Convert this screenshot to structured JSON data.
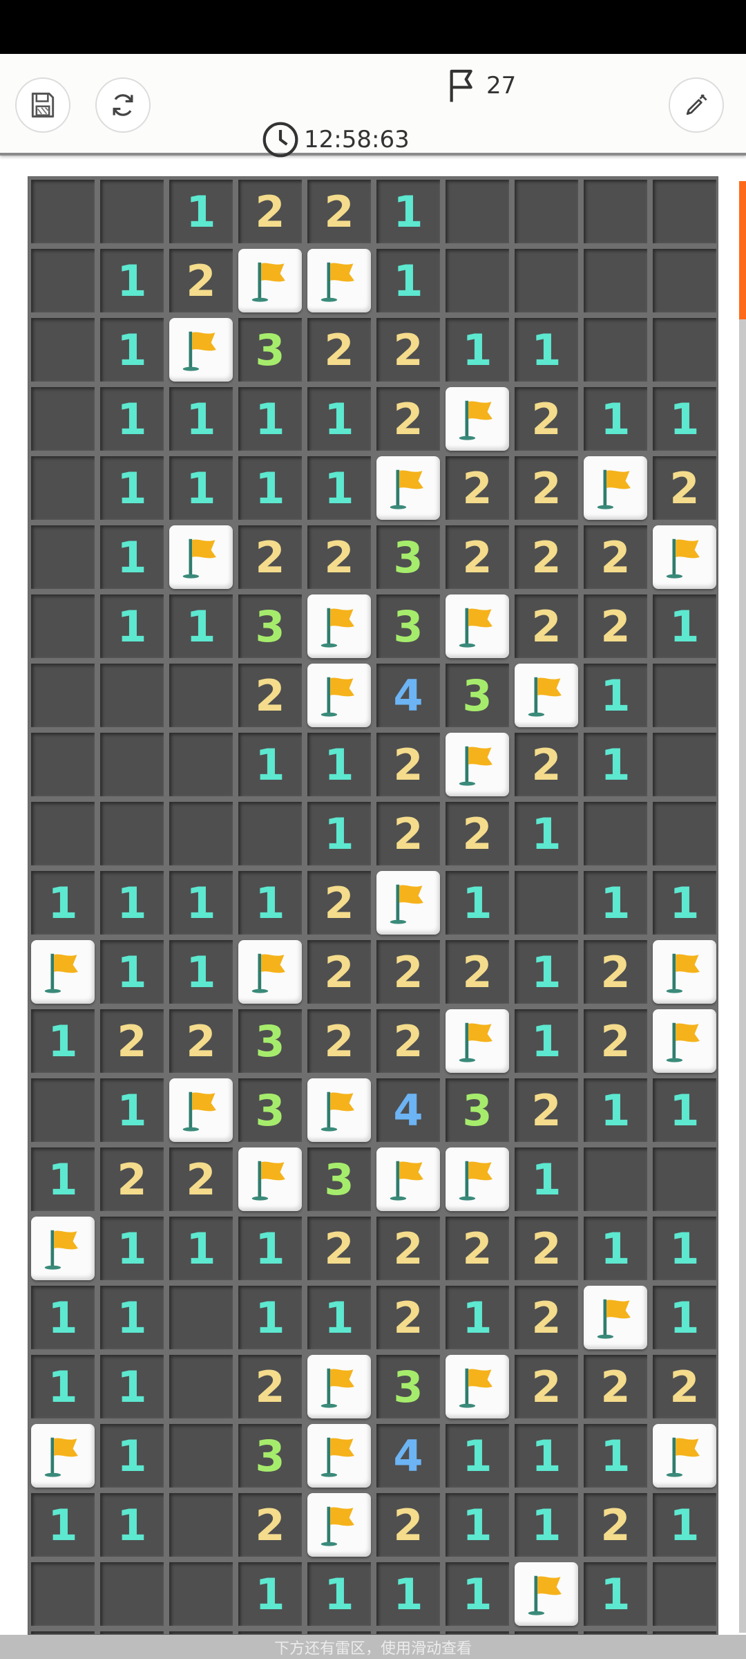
{
  "toolbar": {
    "save_icon": "save-icon",
    "restart_icon": "restart-icon",
    "timer_text": "12:58:63",
    "flag_count": "27",
    "shovel_icon": "shovel-icon"
  },
  "board": {
    "columns": 10,
    "rows": [
      [
        "",
        "",
        "1",
        "2",
        "2",
        "1",
        "",
        "",
        "",
        ""
      ],
      [
        "",
        "1",
        "2",
        "F",
        "F",
        "1",
        "",
        "",
        "",
        ""
      ],
      [
        "",
        "1",
        "F",
        "3",
        "2",
        "2",
        "1",
        "1",
        "",
        ""
      ],
      [
        "",
        "1",
        "1",
        "1",
        "1",
        "2",
        "F",
        "2",
        "1",
        "1"
      ],
      [
        "",
        "1",
        "1",
        "1",
        "1",
        "F",
        "2",
        "2",
        "F",
        "2"
      ],
      [
        "",
        "1",
        "F",
        "2",
        "2",
        "3",
        "2",
        "2",
        "2",
        "F"
      ],
      [
        "",
        "1",
        "1",
        "3",
        "F",
        "3",
        "F",
        "2",
        "2",
        "1"
      ],
      [
        "",
        "",
        "",
        "2",
        "F",
        "4",
        "3",
        "F",
        "1",
        ""
      ],
      [
        "",
        "",
        "",
        "1",
        "1",
        "2",
        "F",
        "2",
        "1",
        ""
      ],
      [
        "",
        "",
        "",
        "",
        "1",
        "2",
        "2",
        "1",
        "",
        ""
      ],
      [
        "1",
        "1",
        "1",
        "1",
        "2",
        "F",
        "1",
        "",
        "1",
        "1"
      ],
      [
        "F",
        "1",
        "1",
        "F",
        "2",
        "2",
        "2",
        "1",
        "2",
        "F"
      ],
      [
        "1",
        "2",
        "2",
        "3",
        "2",
        "2",
        "F",
        "1",
        "2",
        "F"
      ],
      [
        "",
        "1",
        "F",
        "3",
        "F",
        "4",
        "3",
        "2",
        "1",
        "1"
      ],
      [
        "1",
        "2",
        "2",
        "F",
        "3",
        "F",
        "F",
        "1",
        "",
        ""
      ],
      [
        "F",
        "1",
        "1",
        "1",
        "2",
        "2",
        "2",
        "2",
        "1",
        "1"
      ],
      [
        "1",
        "1",
        "",
        "1",
        "1",
        "2",
        "1",
        "2",
        "F",
        "1"
      ],
      [
        "1",
        "1",
        "",
        "2",
        "F",
        "3",
        "F",
        "2",
        "2",
        "2"
      ],
      [
        "F",
        "1",
        "",
        "3",
        "F",
        "4",
        "1",
        "1",
        "1",
        "F"
      ],
      [
        "1",
        "1",
        "",
        "2",
        "F",
        "2",
        "1",
        "1",
        "2",
        "1"
      ],
      [
        "",
        "",
        "",
        "1",
        "1",
        "1",
        "1",
        "F",
        "1",
        ""
      ],
      [
        "",
        "",
        "",
        "",
        "",
        "",
        "",
        "",
        "",
        ""
      ]
    ],
    "number_colors": {
      "1": "#5de8d0",
      "2": "#f4dc8c",
      "3": "#a6ec6c",
      "4": "#6cb4f4"
    },
    "flag_color": "#f5b21a"
  },
  "footer": {
    "hint": "下方还有雷区，使用滑动查看"
  },
  "colors": {
    "accent": "#ff6a1a",
    "board_bg": "#6f6f6f",
    "cell_bg": "#4f4f4f"
  }
}
